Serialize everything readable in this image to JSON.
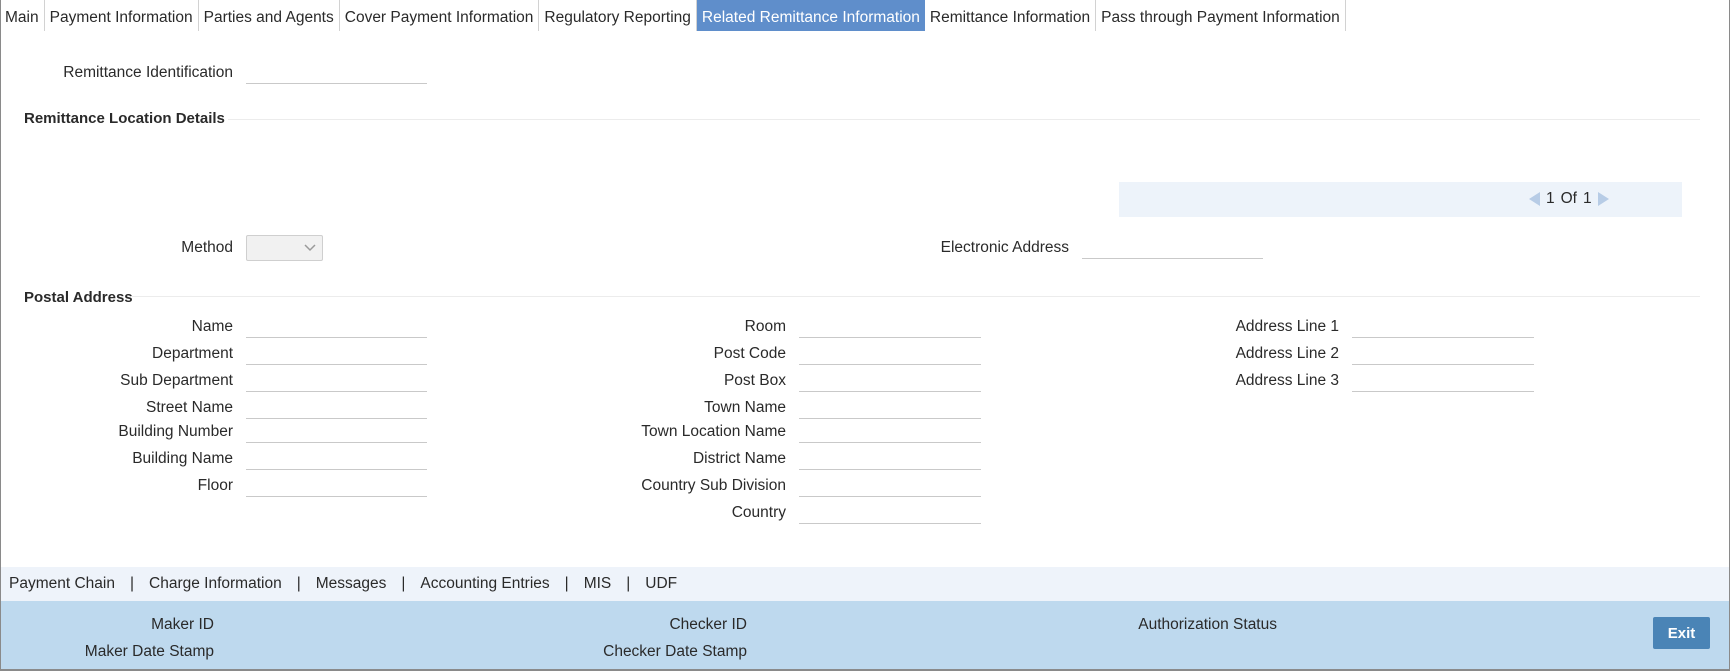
{
  "tabs": [
    {
      "label": "Main"
    },
    {
      "label": "Payment Information"
    },
    {
      "label": "Parties and Agents"
    },
    {
      "label": "Cover Payment Information"
    },
    {
      "label": "Regulatory Reporting"
    },
    {
      "label": "Related Remittance Information",
      "active": true
    },
    {
      "label": "Remittance Information"
    },
    {
      "label": "Pass through Payment Information"
    }
  ],
  "remittance": {
    "identification_label": "Remittance Identification",
    "identification_value": ""
  },
  "location": {
    "title": "Remittance Location Details",
    "pager": {
      "current": "1",
      "of_label": "Of",
      "total": "1"
    },
    "method_label": "Method",
    "method_value": "",
    "electronic_address_label": "Electronic Address",
    "electronic_address_value": ""
  },
  "postal": {
    "title": "Postal Address",
    "col1": {
      "name": "Name",
      "department": "Department",
      "sub_department": "Sub Department",
      "street_name": "Street Name",
      "building_number": "Building Number",
      "building_name": "Building Name",
      "floor": "Floor"
    },
    "col2": {
      "room": "Room",
      "post_code": "Post Code",
      "post_box": "Post Box",
      "town_name": "Town Name",
      "town_location_name": "Town Location Name",
      "district_name": "District Name",
      "country_sub_division": "Country Sub Division",
      "country": "Country"
    },
    "col3": {
      "address_line_1": "Address Line 1",
      "address_line_2": "Address Line 2",
      "address_line_3": "Address Line 3"
    }
  },
  "footer": {
    "links": [
      "Payment Chain",
      "Charge Information",
      "Messages",
      "Accounting Entries",
      "MIS",
      "UDF"
    ],
    "separator": "|",
    "maker_id_label": "Maker ID",
    "maker_date_label": "Maker Date Stamp",
    "checker_id_label": "Checker ID",
    "checker_date_label": "Checker Date Stamp",
    "auth_status_label": "Authorization Status",
    "exit_label": "Exit"
  },
  "colors": {
    "active_tab": "#5f8ecb",
    "sub_toolbar": "#eef3fa",
    "audit_bar": "#bed9ee",
    "exit_button": "#4a84b6"
  }
}
